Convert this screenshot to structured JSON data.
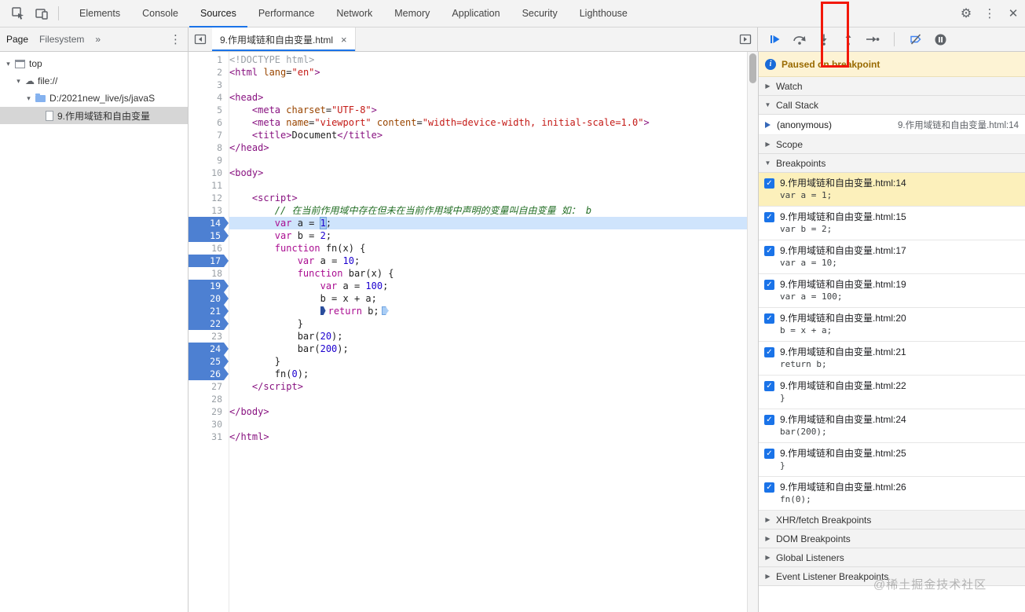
{
  "devtools": {
    "tabs": [
      "Elements",
      "Console",
      "Sources",
      "Performance",
      "Network",
      "Memory",
      "Application",
      "Security",
      "Lighthouse"
    ],
    "active_tab": "Sources"
  },
  "icons": {
    "gear": "⚙",
    "more": "⋮",
    "close": "✕",
    "overflow": "»",
    "cloud": "☁",
    "check": "✓",
    "info": "i",
    "toolbar_icons": [
      "inspect-cursor",
      "device-toolbar",
      "resume",
      "step-over",
      "step-into",
      "step-out",
      "step",
      "deactivate-breakpoints",
      "pause-on-exceptions"
    ]
  },
  "navigator": {
    "tabs": [
      "Page",
      "Filesystem"
    ],
    "tree": [
      {
        "label": "top",
        "icon": "frame",
        "depth": 0,
        "twisty": "▾",
        "selected": false
      },
      {
        "label": "file://",
        "icon": "cloud",
        "depth": 1,
        "twisty": "▾",
        "selected": false
      },
      {
        "label": "D:/2021new_live/js/javaS",
        "icon": "folder",
        "depth": 2,
        "twisty": "▾",
        "selected": false
      },
      {
        "label": "9.作用域链和自由变量",
        "icon": "file",
        "depth": 3,
        "twisty": "",
        "selected": true
      }
    ]
  },
  "editor": {
    "tab": {
      "title": "9.作用域链和自由变量.html",
      "close": "×"
    },
    "current_line": 14,
    "breakpoint_lines": [
      14,
      15,
      17,
      19,
      20,
      21,
      22,
      24,
      25,
      26
    ],
    "lines": [
      [
        [
          "gray",
          "<!DOCTYPE html>"
        ]
      ],
      [
        [
          "tag",
          "<html"
        ],
        [
          "plain",
          " "
        ],
        [
          "attr",
          "lang"
        ],
        [
          "plain",
          "="
        ],
        [
          "str",
          "\"en\""
        ],
        [
          "tag",
          ">"
        ]
      ],
      [],
      [
        [
          "tag",
          "<head>"
        ]
      ],
      [
        [
          "plain",
          "    "
        ],
        [
          "tag",
          "<meta"
        ],
        [
          "plain",
          " "
        ],
        [
          "attr",
          "charset"
        ],
        [
          "plain",
          "="
        ],
        [
          "str",
          "\"UTF-8\""
        ],
        [
          "tag",
          ">"
        ]
      ],
      [
        [
          "plain",
          "    "
        ],
        [
          "tag",
          "<meta"
        ],
        [
          "plain",
          " "
        ],
        [
          "attr",
          "name"
        ],
        [
          "plain",
          "="
        ],
        [
          "str",
          "\"viewport\""
        ],
        [
          "plain",
          " "
        ],
        [
          "attr",
          "content"
        ],
        [
          "plain",
          "="
        ],
        [
          "str",
          "\"width=device-width, initial-scale=1.0\""
        ],
        [
          "tag",
          ">"
        ]
      ],
      [
        [
          "plain",
          "    "
        ],
        [
          "tag",
          "<title>"
        ],
        [
          "plain",
          "Document"
        ],
        [
          "tag",
          "</title>"
        ]
      ],
      [
        [
          "tag",
          "</head>"
        ]
      ],
      [],
      [
        [
          "tag",
          "<body>"
        ]
      ],
      [],
      [
        [
          "plain",
          "    "
        ],
        [
          "tag",
          "<script>"
        ]
      ],
      [
        [
          "plain",
          "        "
        ],
        [
          "com",
          "// 在当前作用域中存在但未在当前作用域中声明的变量叫自由变量 如： b"
        ]
      ],
      [
        [
          "plain",
          "        "
        ],
        [
          "kw",
          "var"
        ],
        [
          "plain",
          " a = "
        ],
        [
          "numsel",
          "1"
        ],
        [
          "plain",
          ";"
        ]
      ],
      [
        [
          "plain",
          "        "
        ],
        [
          "kw",
          "var"
        ],
        [
          "plain",
          " b = "
        ],
        [
          "num",
          "2"
        ],
        [
          "plain",
          ";"
        ]
      ],
      [
        [
          "plain",
          "        "
        ],
        [
          "kw",
          "function"
        ],
        [
          "plain",
          " fn(x) {"
        ]
      ],
      [
        [
          "plain",
          "            "
        ],
        [
          "kw",
          "var"
        ],
        [
          "plain",
          " a = "
        ],
        [
          "num",
          "10"
        ],
        [
          "plain",
          ";"
        ]
      ],
      [
        [
          "plain",
          "            "
        ],
        [
          "kw",
          "function"
        ],
        [
          "plain",
          " bar(x) {"
        ]
      ],
      [
        [
          "plain",
          "                "
        ],
        [
          "kw",
          "var"
        ],
        [
          "plain",
          " a = "
        ],
        [
          "num",
          "100"
        ],
        [
          "plain",
          ";"
        ]
      ],
      [
        [
          "plain",
          "                b = x + a;"
        ]
      ],
      [
        [
          "plain",
          "                "
        ],
        [
          "markdark",
          ""
        ],
        [
          "kw",
          "return"
        ],
        [
          "plain",
          " b;"
        ],
        [
          "marklight",
          ""
        ]
      ],
      [
        [
          "plain",
          "            }"
        ]
      ],
      [
        [
          "plain",
          "            bar("
        ],
        [
          "num",
          "20"
        ],
        [
          "plain",
          ");"
        ]
      ],
      [
        [
          "plain",
          "            bar("
        ],
        [
          "num",
          "200"
        ],
        [
          "plain",
          ");"
        ]
      ],
      [
        [
          "plain",
          "        }"
        ]
      ],
      [
        [
          "plain",
          "        fn("
        ],
        [
          "num",
          "0"
        ],
        [
          "plain",
          ");"
        ]
      ],
      [
        [
          "plain",
          "    "
        ],
        [
          "tag",
          "</script>"
        ]
      ],
      [],
      [
        [
          "tag",
          "</body>"
        ]
      ],
      [],
      [
        [
          "tag",
          "</html>"
        ]
      ]
    ]
  },
  "debugger": {
    "paused_message": "Paused on breakpoint",
    "watch": {
      "arrow": "▶",
      "label": "Watch"
    },
    "call_stack": {
      "arrow": "▼",
      "label": "Call Stack",
      "frame": {
        "name": "(anonymous)",
        "location": "9.作用域链和自由变量.html:14"
      }
    },
    "scope": {
      "arrow": "▶",
      "label": "Scope"
    },
    "breakpoints": {
      "arrow": "▼",
      "label": "Breakpoints",
      "items": [
        {
          "title": "9.作用域链和自由变量.html:14",
          "snippet": "var a = 1;",
          "checked": true,
          "active": true
        },
        {
          "title": "9.作用域链和自由变量.html:15",
          "snippet": "var b = 2;",
          "checked": true,
          "active": false
        },
        {
          "title": "9.作用域链和自由变量.html:17",
          "snippet": "var a = 10;",
          "checked": true,
          "active": false
        },
        {
          "title": "9.作用域链和自由变量.html:19",
          "snippet": "var a = 100;",
          "checked": true,
          "active": false
        },
        {
          "title": "9.作用域链和自由变量.html:20",
          "snippet": "b = x + a;",
          "checked": true,
          "active": false
        },
        {
          "title": "9.作用域链和自由变量.html:21",
          "snippet": "return b;",
          "checked": true,
          "active": false
        },
        {
          "title": "9.作用域链和自由变量.html:22",
          "snippet": "}",
          "checked": true,
          "active": false
        },
        {
          "title": "9.作用域链和自由变量.html:24",
          "snippet": "bar(200);",
          "checked": true,
          "active": false
        },
        {
          "title": "9.作用域链和自由变量.html:25",
          "snippet": "}",
          "checked": true,
          "active": false
        },
        {
          "title": "9.作用域链和自由变量.html:26",
          "snippet": "fn(0);",
          "checked": true,
          "active": false
        }
      ]
    },
    "xhr": {
      "arrow": "▶",
      "label": "XHR/fetch Breakpoints"
    },
    "dom": {
      "arrow": "▶",
      "label": "DOM Breakpoints"
    },
    "global": {
      "arrow": "▶",
      "label": "Global Listeners"
    },
    "event": {
      "arrow": "▶",
      "label": "Event Listener Breakpoints"
    }
  },
  "colors": {
    "accent_blue": "#1a73e8",
    "breakpoint_blue": "#4d80d2",
    "current_line_bg": "#cfe4fc",
    "paused_banner_bg": "#fdf3d4",
    "active_breakpoint_bg": "#fcf0bb",
    "annotation_red": "#f2180a"
  },
  "watermark": "@稀土掘金技术社区"
}
